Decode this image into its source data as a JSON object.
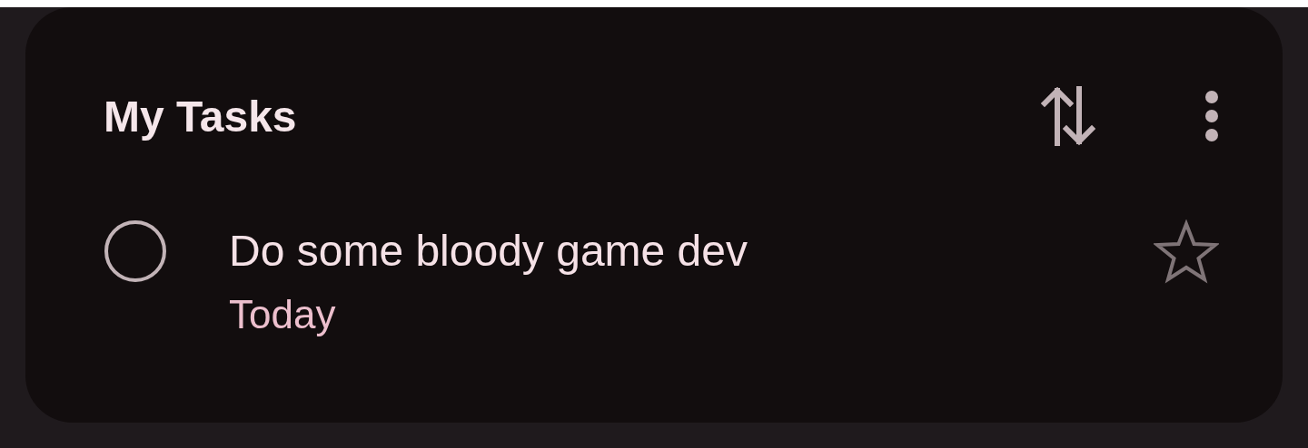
{
  "header": {
    "title": "My Tasks"
  },
  "tasks": [
    {
      "title": "Do some bloody game dev",
      "due": "Today",
      "completed": false,
      "starred": false
    }
  ]
}
